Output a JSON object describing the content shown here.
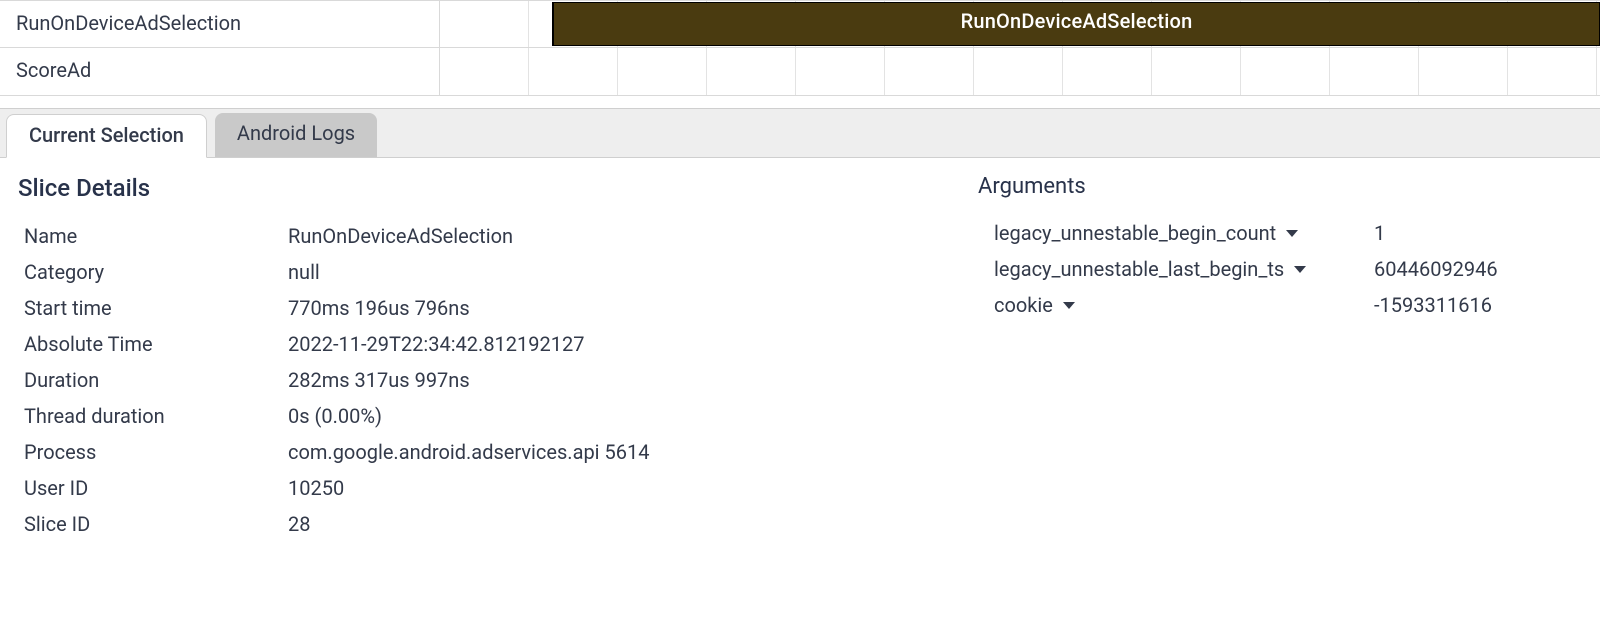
{
  "tracks": {
    "row1_label": "RunOnDeviceAdSelection",
    "row1_slice_label": "RunOnDeviceAdSelection",
    "row2_label": "ScoreAd"
  },
  "tabs": {
    "current_selection": "Current Selection",
    "android_logs": "Android Logs"
  },
  "details": {
    "title": "Slice Details",
    "fields": {
      "name": {
        "k": "Name",
        "v": "RunOnDeviceAdSelection"
      },
      "category": {
        "k": "Category",
        "v": "null"
      },
      "start_time": {
        "k": "Start time",
        "v": "770ms 196us 796ns"
      },
      "absolute_time": {
        "k": "Absolute Time",
        "v": "2022-11-29T22:34:42.812192127"
      },
      "duration": {
        "k": "Duration",
        "v": "282ms 317us 997ns"
      },
      "thread_duration": {
        "k": "Thread duration",
        "v": "0s (0.00%)"
      },
      "process": {
        "k": "Process",
        "v": "com.google.android.adservices.api 5614"
      },
      "user_id": {
        "k": "User ID",
        "v": "10250"
      },
      "slice_id": {
        "k": "Slice ID",
        "v": "28"
      }
    }
  },
  "arguments": {
    "title": "Arguments",
    "items": {
      "a": {
        "k": "legacy_unnestable_begin_count",
        "v": "1"
      },
      "b": {
        "k": "legacy_unnestable_last_begin_ts",
        "v": "60446092946"
      },
      "c": {
        "k": "cookie",
        "v": "-1593311616"
      }
    }
  }
}
